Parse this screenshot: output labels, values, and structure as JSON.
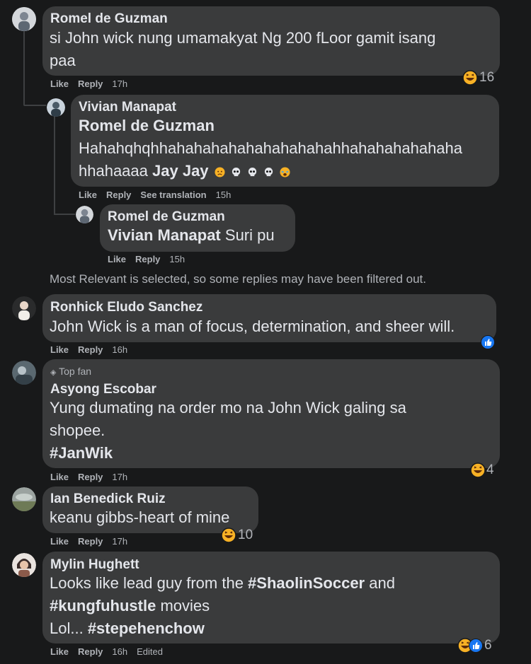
{
  "comments": [
    {
      "author": "Romel de Guzman",
      "line1": "si John wick nung umamakyat Ng 200 fLoor gamit isang",
      "line2": "paa",
      "like": "Like",
      "reply": "Reply",
      "time": "17h",
      "reaction_icon": "haha-emoji",
      "reaction_count": "16"
    },
    {
      "author": "Vivian Manapat",
      "mention": "Romel de Guzman",
      "line1": "Hahahqhqhhahahahahahahahahahahhahahahahahaha",
      "line2": "hhahaaaa",
      "line2_mention": "Jay Jay",
      "emojis": [
        "sad-emoji",
        "skull-emoji",
        "skull-emoji",
        "skull-emoji",
        "crying-emoji"
      ],
      "like": "Like",
      "reply": "Reply",
      "see_translation": "See translation",
      "time": "15h"
    },
    {
      "author": "Romel de Guzman",
      "mention": "Vivian Manapat",
      "text": "Suri pu",
      "like": "Like",
      "reply": "Reply",
      "time": "15h"
    },
    {
      "author": "Ronhick Eludo Sanchez",
      "line1": "John Wick is a man of focus, determination, and sheer will.",
      "like": "Like",
      "reply": "Reply",
      "time": "16h",
      "reaction_icon": "like-emoji"
    },
    {
      "badge": "Top fan",
      "author": "Asyong Escobar",
      "line1": "Yung dumating na order mo na John Wick galing sa",
      "line2": "shopee.",
      "line3": "#JanWik",
      "like": "Like",
      "reply": "Reply",
      "time": "17h",
      "reaction_icon": "haha-emoji",
      "reaction_count": "4"
    },
    {
      "author": "Ian Benedick Ruiz",
      "line1": "keanu gibbs-heart of mine",
      "like": "Like",
      "reply": "Reply",
      "time": "17h",
      "reaction_icon": "haha-emoji",
      "reaction_count": "10"
    },
    {
      "author": "Mylin Hughett",
      "line1_pre": "Looks like lead guy from the ",
      "line1_tag": "#ShaolinSoccer",
      "line1_post": " and",
      "line2_tag": "#kungfuhustle",
      "line2_post": " movies",
      "line3_pre": "Lol... ",
      "line3_tag": "#stepehenchow",
      "like": "Like",
      "reply": "Reply",
      "time": "16h",
      "edited": "Edited",
      "reaction_count": "6"
    }
  ],
  "filter_note": "Most Relevant is selected, so some replies may have been filtered out.",
  "colors": {
    "background": "#18191a",
    "bubble": "#3a3b3c",
    "text": "#e4e6eb",
    "secondary": "#b0b3b8",
    "like_blue": "#1877f2",
    "haha_yellow": "#f7b125"
  }
}
